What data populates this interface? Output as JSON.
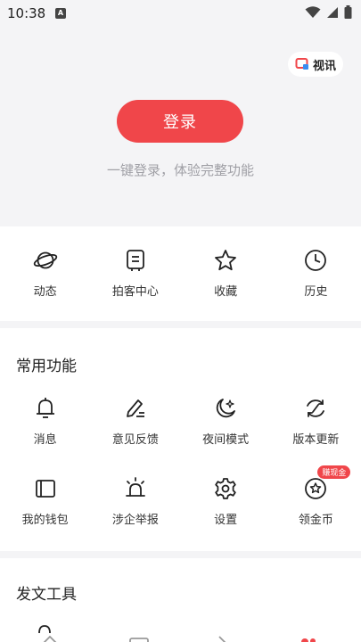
{
  "status_bar": {
    "time": "10:38",
    "notification_glyph": "A"
  },
  "header": {
    "video_chip_label": "视讯",
    "login_button": "登录",
    "login_hint": "一键登录，体验完整功能"
  },
  "quick_actions": [
    {
      "label": "动态",
      "icon": "planet-icon"
    },
    {
      "label": "拍客中心",
      "icon": "camera-card-icon"
    },
    {
      "label": "收藏",
      "icon": "star-icon"
    },
    {
      "label": "历史",
      "icon": "clock-icon"
    }
  ],
  "common_functions": {
    "title": "常用功能",
    "row1": [
      {
        "label": "消息",
        "icon": "bell-icon"
      },
      {
        "label": "意见反馈",
        "icon": "pen-icon"
      },
      {
        "label": "夜间模式",
        "icon": "moon-icon"
      },
      {
        "label": "版本更新",
        "icon": "refresh-icon"
      }
    ],
    "row2": [
      {
        "label": "我的钱包",
        "icon": "wallet-icon"
      },
      {
        "label": "涉企举报",
        "icon": "alarm-icon"
      },
      {
        "label": "设置",
        "icon": "gear-icon"
      },
      {
        "label": "领金币",
        "icon": "coin-icon",
        "badge": "赚现金"
      }
    ]
  },
  "tools": {
    "title": "发文工具"
  },
  "colors": {
    "accent": "#f0464a",
    "background": "#f4f4f6",
    "card": "#ffffff"
  }
}
